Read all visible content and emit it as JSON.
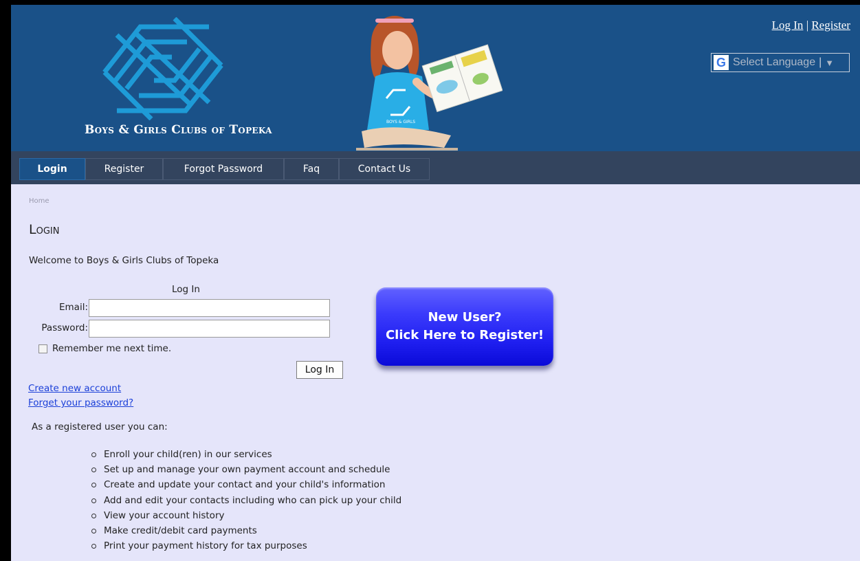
{
  "header": {
    "org_name": "Boys & Girls Clubs of Topeka",
    "auth_links": {
      "login": "Log In",
      "separator": "|",
      "register": "Register"
    },
    "language_selector": {
      "icon": "google-g-icon",
      "glyph": "G",
      "label": "Select Language",
      "separator": "|",
      "arrow": "▼"
    },
    "photo_badge": "BOYS & GIRLS CLUBS OF THE MIDLANDS"
  },
  "nav": {
    "items": [
      {
        "label": "Login",
        "active": true
      },
      {
        "label": "Register",
        "active": false
      },
      {
        "label": "Forgot Password",
        "active": false
      },
      {
        "label": "Faq",
        "active": false
      },
      {
        "label": "Contact Us",
        "active": false
      }
    ]
  },
  "content": {
    "breadcrumb": "Home",
    "title": "Login",
    "welcome": "Welcome to Boys & Girls Clubs of Topeka",
    "login_form": {
      "heading": "Log In",
      "email_label": "Email:",
      "email_value": "",
      "password_label": "Password:",
      "password_value": "",
      "remember_label": "Remember me next time.",
      "remember_checked": false,
      "submit_label": "Log In"
    },
    "register_button": {
      "line1": "New User?",
      "line2": "Click Here to Register!"
    },
    "links": {
      "create_account": "Create new account",
      "forgot_password": "Forget your password?"
    },
    "registered_intro": "As a registered user you can:",
    "benefits": [
      "Enroll your child(ren) in our services",
      "Set up and manage your own payment account and schedule",
      "Create and update your contact and your child's information",
      "Add and edit your contacts including who can pick up your child",
      "View your account history",
      "Make credit/debit card payments",
      "Print your payment history for tax purposes"
    ]
  },
  "colors": {
    "header_bg": "#1a5188",
    "nav_bg": "#33445e",
    "nav_active": "#1a5188",
    "content_bg": "#e5e5fa",
    "register_button": "#2020f0",
    "link": "#1a3fd8",
    "logo": "#1e9bd7"
  }
}
